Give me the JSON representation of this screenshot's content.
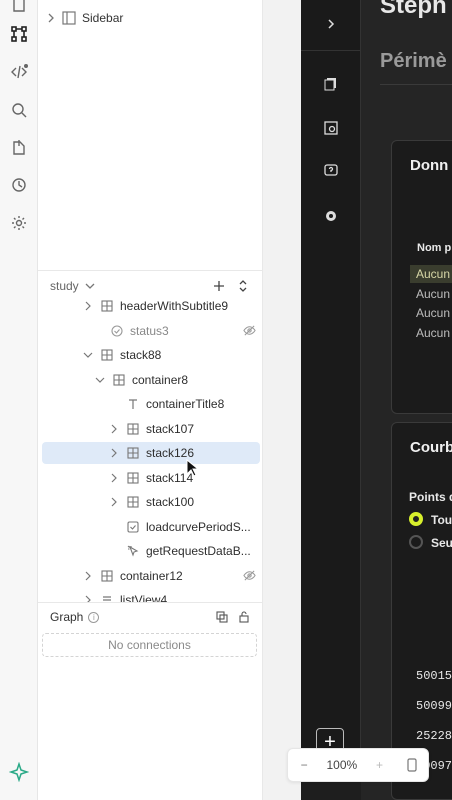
{
  "rail": {
    "icons": [
      "document-icon",
      "component-tree-icon",
      "code-icon",
      "search-icon",
      "export-icon",
      "history-icon",
      "settings-icon"
    ]
  },
  "explorer": {
    "sidebar_node": "Sidebar",
    "study_label": "study",
    "tree": [
      {
        "label": "headerWithSubtitle9",
        "icon": "grid-icon",
        "caret": true,
        "hidden": false
      },
      {
        "label": "status3",
        "icon": "status-icon",
        "caret": false,
        "hidden": true
      },
      {
        "label": "stack88",
        "icon": "grid-icon",
        "caret": "open",
        "hidden": false
      },
      {
        "label": "container8",
        "icon": "grid-icon",
        "caret": "open",
        "hidden": false
      },
      {
        "label": "containerTitle8",
        "icon": "text-icon",
        "caret": false,
        "hidden": false
      },
      {
        "label": "stack107",
        "icon": "grid-icon",
        "caret": true,
        "hidden": false
      },
      {
        "label": "stack126",
        "icon": "grid-icon",
        "caret": true,
        "hidden": false,
        "selected": true
      },
      {
        "label": "stack114",
        "icon": "grid-icon",
        "caret": true,
        "hidden": false
      },
      {
        "label": "stack100",
        "icon": "grid-icon",
        "caret": true,
        "hidden": false
      },
      {
        "label": "loadcurvePeriodS...",
        "icon": "checkbox-icon",
        "caret": false,
        "hidden": false
      },
      {
        "label": "getRequestDataB...",
        "icon": "pointer-icon",
        "caret": false,
        "hidden": false
      },
      {
        "label": "container12",
        "icon": "grid-icon",
        "caret": true,
        "hidden": true
      },
      {
        "label": "listView4",
        "icon": "list-icon",
        "caret": true,
        "hidden": false
      }
    ],
    "graph": {
      "title": "Graph",
      "empty_text": "No connections"
    }
  },
  "canvas": {
    "app": {
      "title": "Stéph",
      "subtitle": "Périmè",
      "card1_title": "Donn",
      "col_head": "Nom p",
      "cells": [
        "Aucun",
        "Aucun",
        "Aucun",
        "Aucun"
      ],
      "card2_title": "Courb",
      "points_label": "Points d",
      "radio_options": [
        "Tou",
        "Seu"
      ],
      "numbers": [
        "50015",
        "50099",
        "25228",
        "50097"
      ]
    },
    "zoom": {
      "level": "100%"
    }
  },
  "colors": {
    "accent": "#2aa987",
    "selection": "#dfeaf8",
    "radio_on": "#d7ef2c"
  }
}
